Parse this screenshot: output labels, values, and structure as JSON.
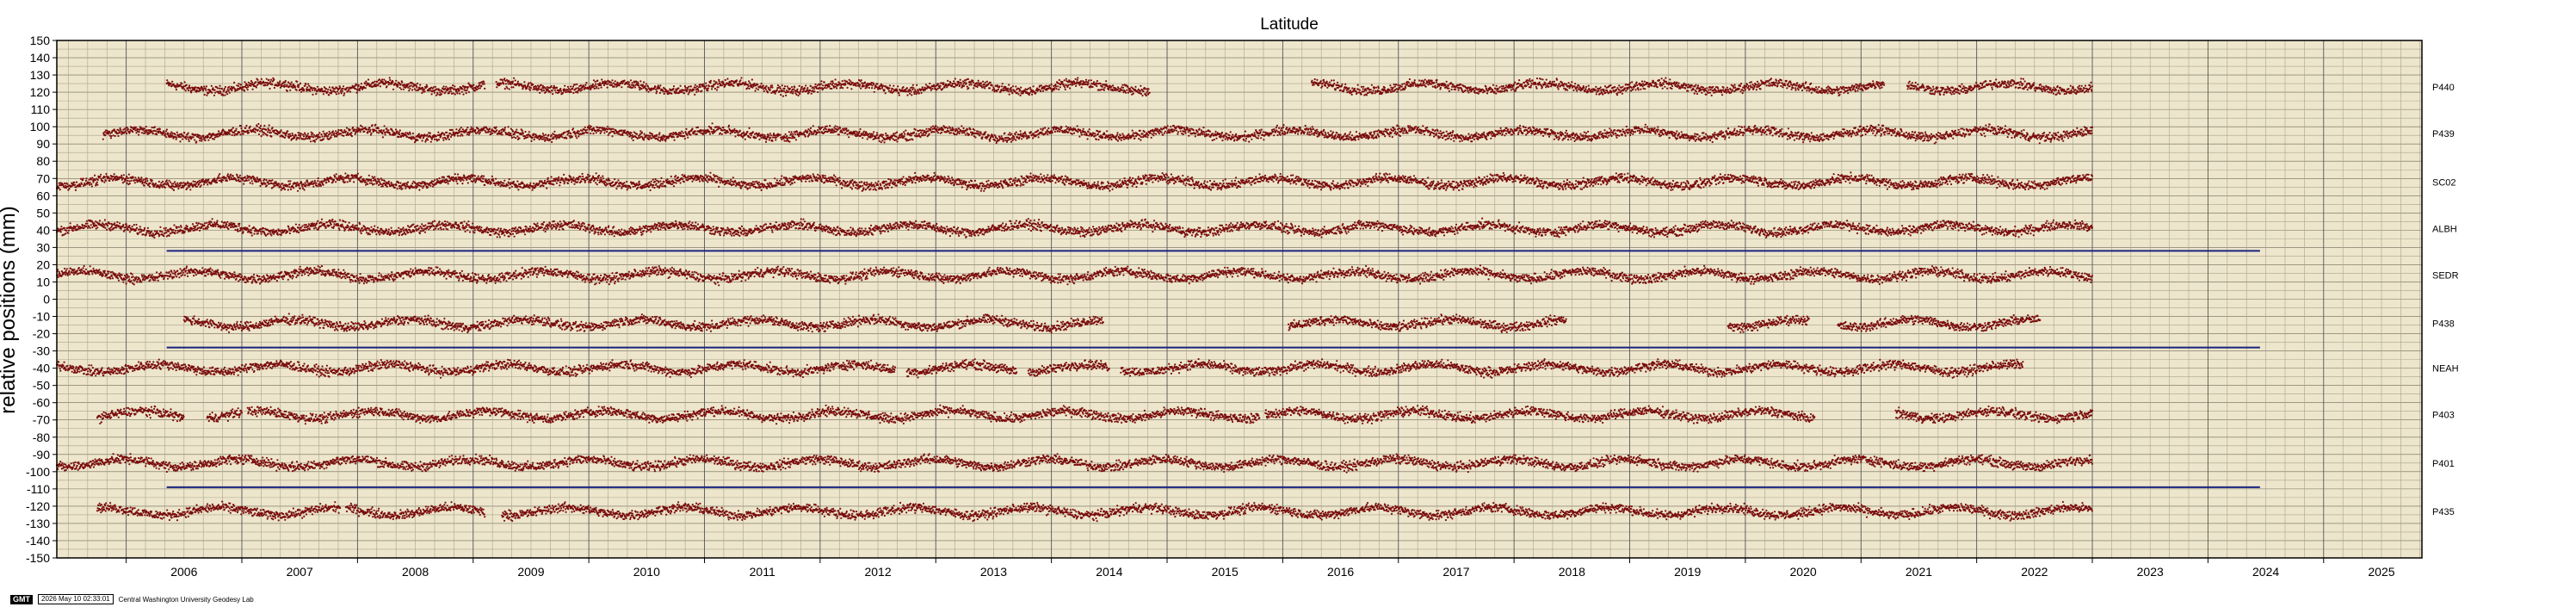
{
  "chart_data": {
    "type": "scatter",
    "title": "Latitude",
    "ylabel": "relative positions (mm)",
    "xlabel": "",
    "xlim": [
      2005.4,
      2025.85
    ],
    "ylim": [
      -150,
      150
    ],
    "x_ticks": [
      "2006",
      "2007",
      "2008",
      "2009",
      "2010",
      "2011",
      "2012",
      "2013",
      "2014",
      "2015",
      "2016",
      "2017",
      "2018",
      "2019",
      "2020",
      "2021",
      "2022",
      "2023",
      "2024",
      "2025"
    ],
    "y_ticks": [
      150,
      140,
      130,
      120,
      110,
      100,
      90,
      80,
      70,
      60,
      50,
      40,
      30,
      20,
      10,
      0,
      -10,
      -20,
      -30,
      -40,
      -50,
      -60,
      -70,
      -80,
      -90,
      -100,
      -110,
      -120,
      -130,
      -140,
      -150
    ],
    "grid": true,
    "background_color": "#ede6cc",
    "point_color": "#7a0d0d",
    "series": [
      {
        "name": "P440",
        "offset": 123,
        "segments": [
          [
            2006.35,
            2008.78
          ],
          [
            2008.78,
            2009.1
          ],
          [
            2009.2,
            2014.85
          ],
          [
            2016.25,
            2017.4
          ],
          [
            2017.4,
            2021.2
          ],
          [
            2021.4,
            2023.0
          ]
        ]
      },
      {
        "name": "P439",
        "offset": 96,
        "segments": [
          [
            2005.8,
            2023.0
          ]
        ]
      },
      {
        "name": "SC02",
        "offset": 68,
        "segments": [
          [
            2005.4,
            2023.0
          ]
        ]
      },
      {
        "name": "ALBH",
        "offset": 41,
        "segments": [
          [
            2005.4,
            2023.0
          ]
        ]
      },
      {
        "name": "SEDR",
        "offset": 14,
        "segments": [
          [
            2005.4,
            2023.0
          ]
        ]
      },
      {
        "name": "P438",
        "offset": -14,
        "segments": [
          [
            2006.5,
            2014.45
          ],
          [
            2016.05,
            2018.45
          ],
          [
            2019.85,
            2020.55
          ],
          [
            2020.8,
            2022.55
          ]
        ]
      },
      {
        "name": "NEAH",
        "offset": -40,
        "segments": [
          [
            2005.4,
            2012.65
          ],
          [
            2012.75,
            2013.7
          ],
          [
            2013.8,
            2014.5
          ],
          [
            2014.6,
            2022.4
          ]
        ]
      },
      {
        "name": "P403",
        "offset": -67,
        "segments": [
          [
            2005.75,
            2006.5
          ],
          [
            2006.7,
            2007.0
          ],
          [
            2007.05,
            2015.8
          ],
          [
            2015.85,
            2017.05
          ],
          [
            2017.05,
            2020.6
          ],
          [
            2021.3,
            2023.0
          ]
        ]
      },
      {
        "name": "P401",
        "offset": -95,
        "segments": [
          [
            2005.4,
            2023.0
          ]
        ]
      },
      {
        "name": "P435",
        "offset": -123,
        "segments": [
          [
            2005.75,
            2007.85
          ],
          [
            2007.9,
            2009.1
          ],
          [
            2009.25,
            2023.0
          ]
        ]
      }
    ],
    "reference_lines": [
      {
        "y": 28,
        "x": [
          2006.35,
          2024.45
        ],
        "color": "#1a237e"
      },
      {
        "y": -28,
        "x": [
          2006.35,
          2024.45
        ],
        "color": "#1a237e"
      },
      {
        "y": -109,
        "x": [
          2006.35,
          2024.45
        ],
        "color": "#1a237e"
      }
    ]
  },
  "footer": {
    "badge": "GMT",
    "timestamp": "2026 May 10 02:33:01",
    "credit": "Central Washington University Geodesy Lab"
  }
}
